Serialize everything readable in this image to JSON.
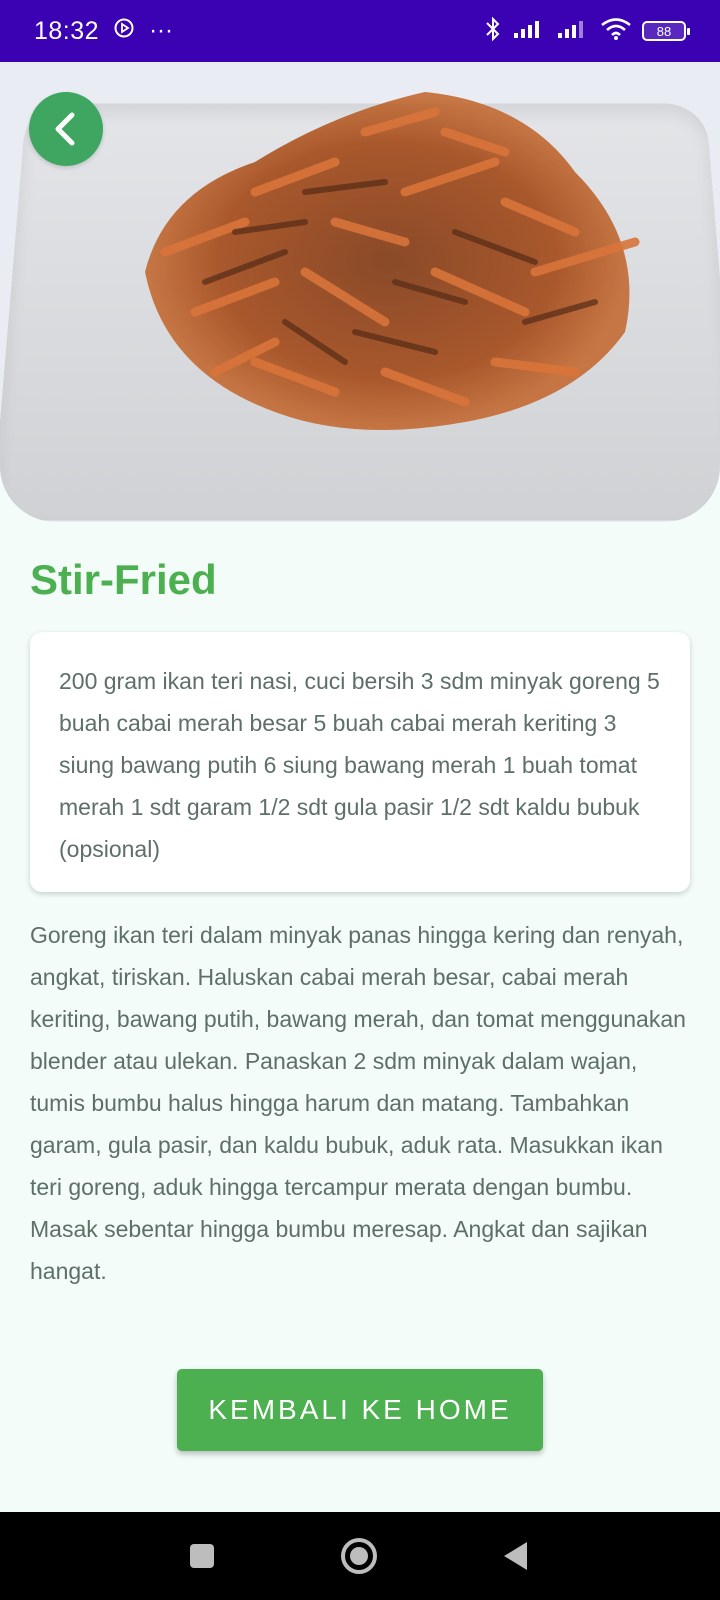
{
  "status_bar": {
    "time": "18:32",
    "more": "···",
    "battery": "88",
    "icons": [
      "sync-icon",
      "bluetooth-icon",
      "signal-icon",
      "signal-icon",
      "wifi-icon",
      "battery-icon"
    ]
  },
  "recipe": {
    "title": "Stir-Fried",
    "ingredients": "200 gram ikan teri nasi, cuci bersih 3 sdm minyak goreng 5 buah cabai merah besar 5 buah cabai merah keriting 3 siung bawang putih 6 siung bawang merah 1 buah tomat merah 1 sdt garam 1/2 sdt gula pasir 1/2 sdt kaldu bubuk (opsional)",
    "steps": "Goreng ikan teri dalam minyak panas hingga kering dan renyah, angkat, tiriskan. Haluskan cabai merah besar, cabai merah keriting, bawang putih, bawang merah, dan tomat menggunakan blender atau ulekan. Panaskan 2 sdm minyak dalam wajan, tumis bumbu halus hingga harum dan matang. Tambahkan garam, gula pasir, dan kaldu bubuk, aduk rata. Masukkan ikan teri goreng, aduk hingga tercampur merata dengan bumbu. Masak sebentar hingga bumbu meresap. Angkat dan sajikan hangat."
  },
  "buttons": {
    "home_label": "KEMBALI KE HOME"
  },
  "colors": {
    "status_bar": "#3a02b3",
    "accent": "#4caf50",
    "back_button": "#3ea660",
    "background": "#f3fcf8",
    "text": "#5e6f68"
  },
  "nav_bar": {
    "icons": [
      "recents-icon",
      "home-icon",
      "back-icon"
    ]
  }
}
